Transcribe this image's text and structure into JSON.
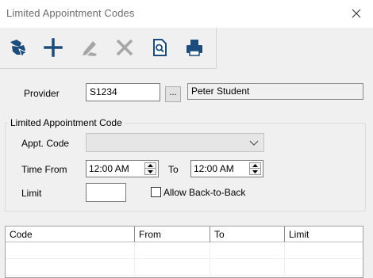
{
  "window": {
    "title": "Limited Appointment Codes"
  },
  "toolbar": {
    "buttons": [
      {
        "icon": "select-provider-icon",
        "enabled": true
      },
      {
        "icon": "add-icon",
        "enabled": true
      },
      {
        "icon": "edit-icon",
        "enabled": false
      },
      {
        "icon": "delete-icon",
        "enabled": false
      },
      {
        "icon": "preview-icon",
        "enabled": true
      },
      {
        "icon": "print-icon",
        "enabled": true
      }
    ]
  },
  "provider": {
    "label": "Provider",
    "code": "S1234",
    "lookup_label": "...",
    "name": "Peter Student"
  },
  "limited_code": {
    "group_title": "Limited Appointment Code",
    "appt_code_label": "Appt. Code",
    "appt_code_value": "",
    "time_from_label": "Time From",
    "time_from_value": "12:00 AM",
    "to_label": "To",
    "time_to_value": "12:00 AM",
    "limit_label": "Limit",
    "limit_value": "",
    "allow_back_to_back_label": "Allow Back-to-Back",
    "allow_back_to_back_checked": false
  },
  "grid": {
    "columns": [
      "Code",
      "From",
      "To",
      "Limit"
    ],
    "rows": []
  },
  "colors": {
    "window_bg": "#f0f0f0",
    "title_text": "#6d6d6d",
    "toolbar_icon": "#1c4c7c",
    "disabled_icon": "#a6a6a6"
  }
}
